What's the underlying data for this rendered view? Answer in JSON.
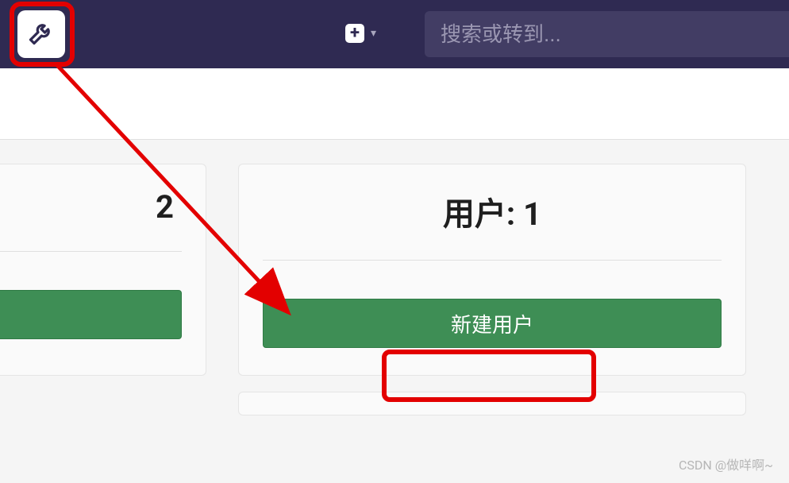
{
  "nav": {
    "search_placeholder": "搜索或转到..."
  },
  "cards": {
    "left_value": "2",
    "user_card": {
      "title": "用户: 1",
      "button_label": "新建用户"
    }
  },
  "watermark": "CSDN @做咩啊~"
}
